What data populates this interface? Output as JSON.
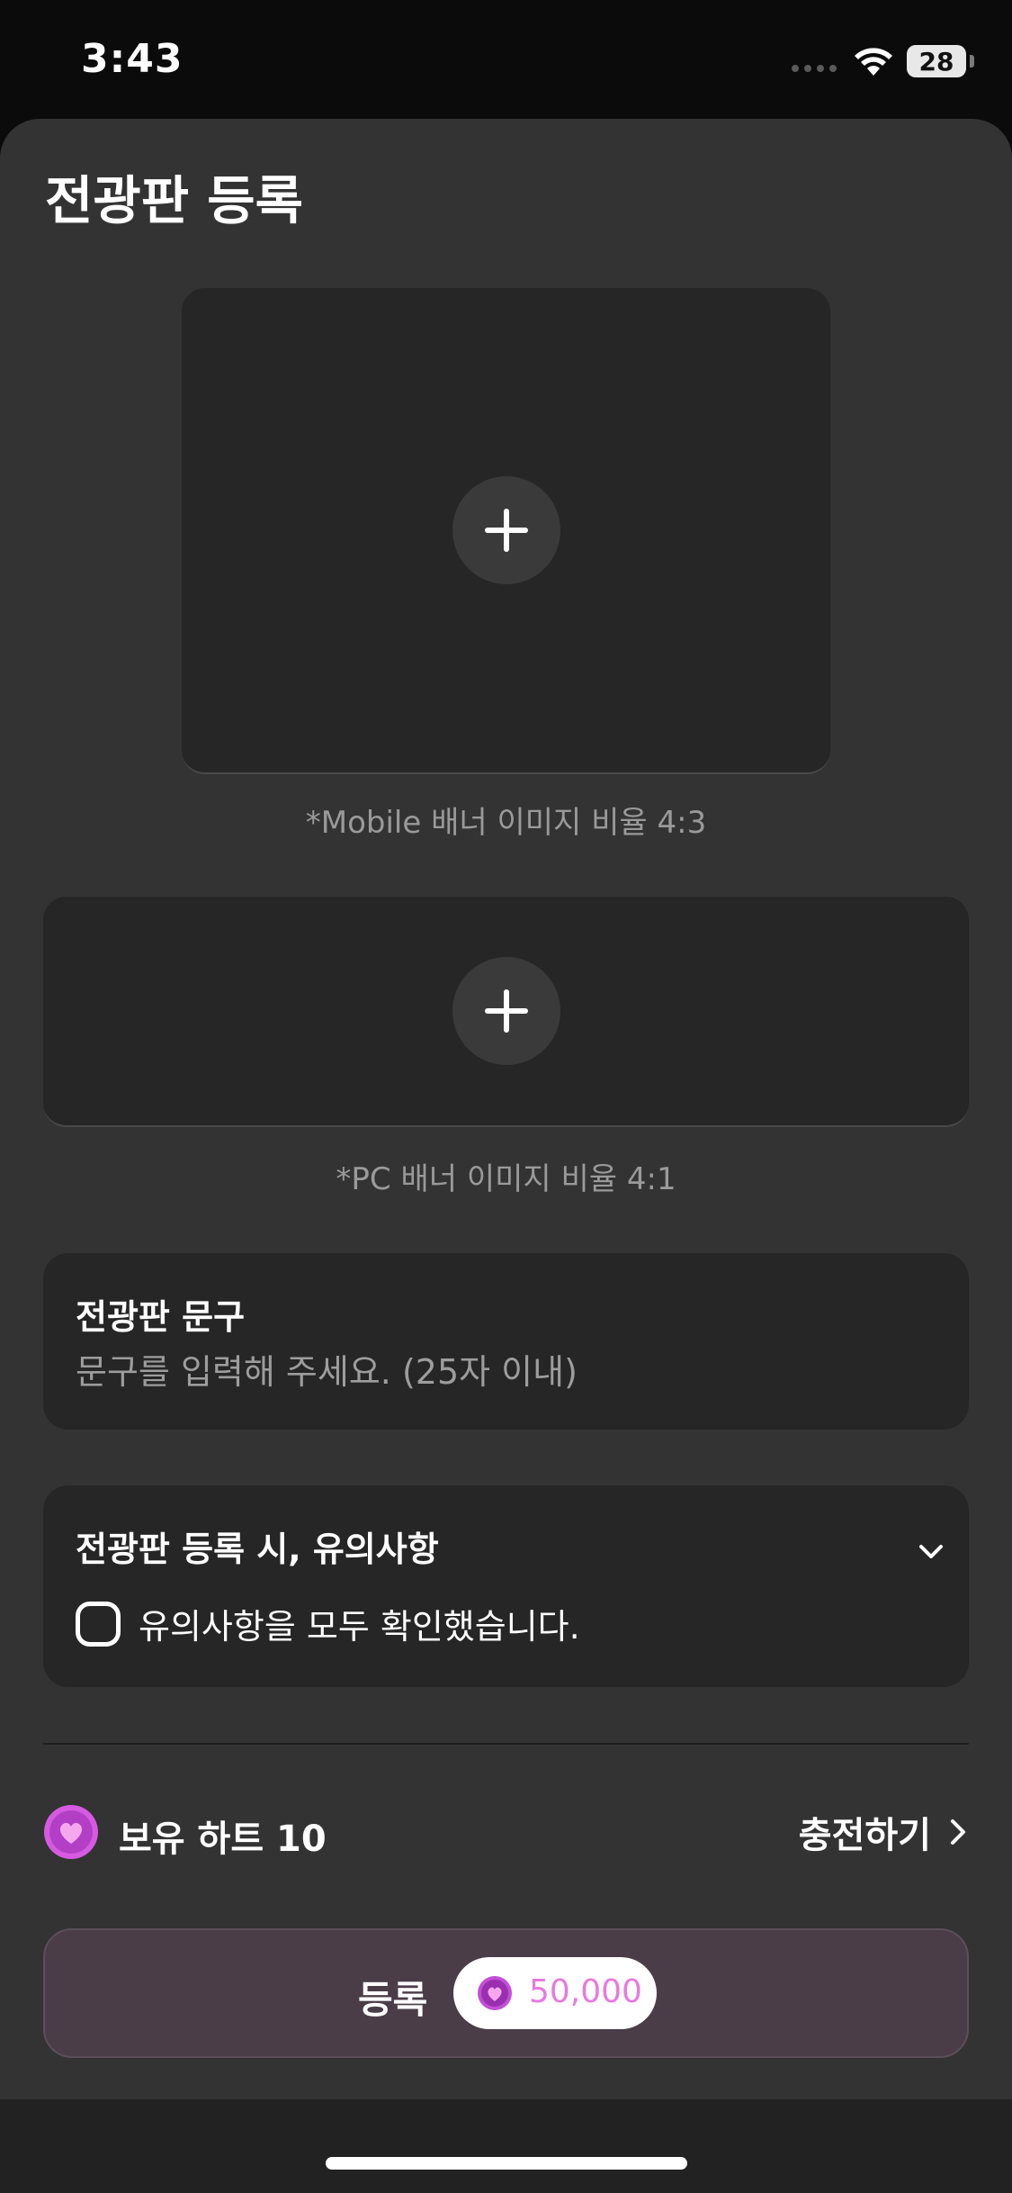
{
  "status_bar": {
    "time": "3:43",
    "battery": "28"
  },
  "sheet": {
    "title": "전광판 등록"
  },
  "uploads": {
    "mobile_caption": "*Mobile 배너 이미지 비율 4:3",
    "pc_caption": "*PC 배너 이미지 비율 4:1"
  },
  "phrase": {
    "label": "전광판 문구",
    "placeholder": "문구를 입력해 주세요. (25자 이내)",
    "value": ""
  },
  "notice": {
    "label": "전광판 등록 시, 유의사항",
    "confirm_label": "유의사항을 모두 확인했습니다.",
    "confirmed": false
  },
  "hearts": {
    "owned_label": "보유 하트 10",
    "charge_label": "충전하기"
  },
  "register": {
    "label": "등록",
    "price": "50,000"
  },
  "colors": {
    "accent": "#e879e0",
    "heart": "#c24fd6",
    "button_bg": "#4a3d48",
    "sheet_bg": "#333333",
    "card_bg": "#262626"
  }
}
